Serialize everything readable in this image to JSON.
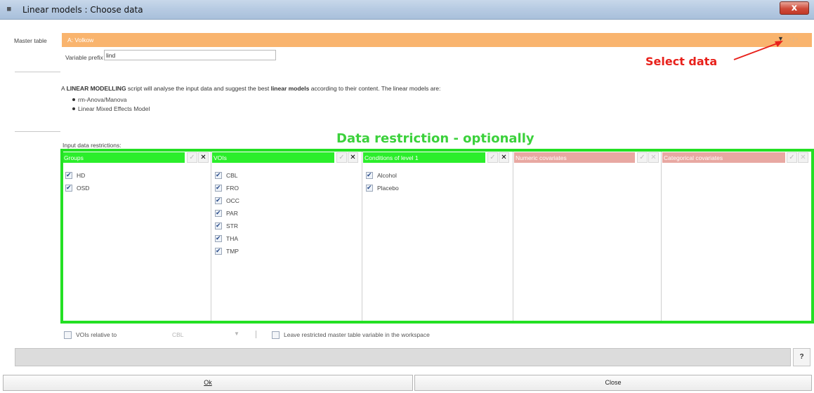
{
  "window": {
    "title": "Linear models : Choose data",
    "close_label": "x",
    "app_icon": "pmod-table-icon"
  },
  "master": {
    "label": "Master table",
    "value": "A:  Volkow",
    "dropdown_glyph": "▼",
    "more_glyph": "‹ | ›"
  },
  "prefix": {
    "label": "Variable prefix",
    "value": "lind"
  },
  "annotations": {
    "select_data": "Select data",
    "restriction": "Data restriction - optionally",
    "arrow_color": "#e8211b",
    "frame_color": "#24e024"
  },
  "description": {
    "before": "A ",
    "strong1": "LINEAR MODELLING",
    "middle": " script will analyse the input data and suggest the best ",
    "strong2": "linear models",
    "after": " according to their content. The linear models are:",
    "bullets": [
      "rm-Anova/Manova",
      "Linear Mixed Effects Model"
    ]
  },
  "restrictions_label": "Input data restrictions:",
  "panels": [
    {
      "title": "Groups",
      "header_color": "#2bee2b",
      "check_glyph": "✓",
      "x_glyph": "✕",
      "items": [
        "HD",
        "OSD"
      ]
    },
    {
      "title": "VOIs",
      "header_color": "#2bee2b",
      "check_glyph": "✓",
      "x_glyph": "✕",
      "items": [
        "CBL",
        "FRO",
        "OCC",
        "PAR",
        "STR",
        "THA",
        "TMP"
      ]
    },
    {
      "title": "Conditions of level 1",
      "header_color": "#2bee2b",
      "check_glyph": "✓",
      "x_glyph": "✕",
      "items": [
        "Alcohol",
        "Placebo"
      ]
    },
    {
      "title": "Numeric covariates",
      "header_color": "#e8a8a2",
      "check_glyph": "✓",
      "x_glyph": "✕",
      "items": []
    },
    {
      "title": "Categorical covariates",
      "header_color": "#e8a8a2",
      "check_glyph": "✓",
      "x_glyph": "✕",
      "items": []
    }
  ],
  "bottom": {
    "vois_relative_label": "VOIs relative to",
    "vois_relative_value": "CBL",
    "combo_arrow": "▼",
    "leave_label": "Leave restricted master table variable in the workspace"
  },
  "help_label": "?",
  "buttons": {
    "ok": "Ok",
    "close": "Close"
  }
}
